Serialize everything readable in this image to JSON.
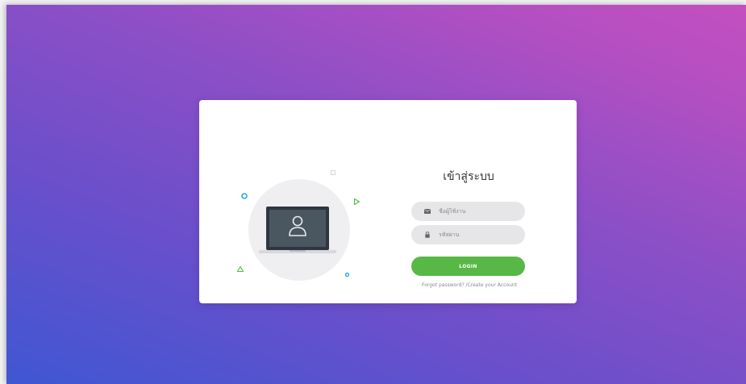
{
  "login": {
    "title": "เข้าสู่ระบบ",
    "username": {
      "placeholder": "ชื่อผู้ใช้งาน",
      "value": "",
      "icon": "envelope-icon"
    },
    "password": {
      "placeholder": "รหัสผ่าน",
      "value": "",
      "icon": "lock-icon"
    },
    "submit_label": "LOGIN",
    "forgot_label": "Forgot password?",
    "separator": " /",
    "create_label": "Create your Account"
  },
  "illustration": {
    "icon": "laptop-user-icon"
  },
  "colors": {
    "gradient_start": "#3f57d3",
    "gradient_end": "#c44fc0",
    "button": "#57b846",
    "field_bg": "#e6e6e8",
    "accent_blue": "#2ea8dc",
    "accent_green": "#57b846"
  }
}
